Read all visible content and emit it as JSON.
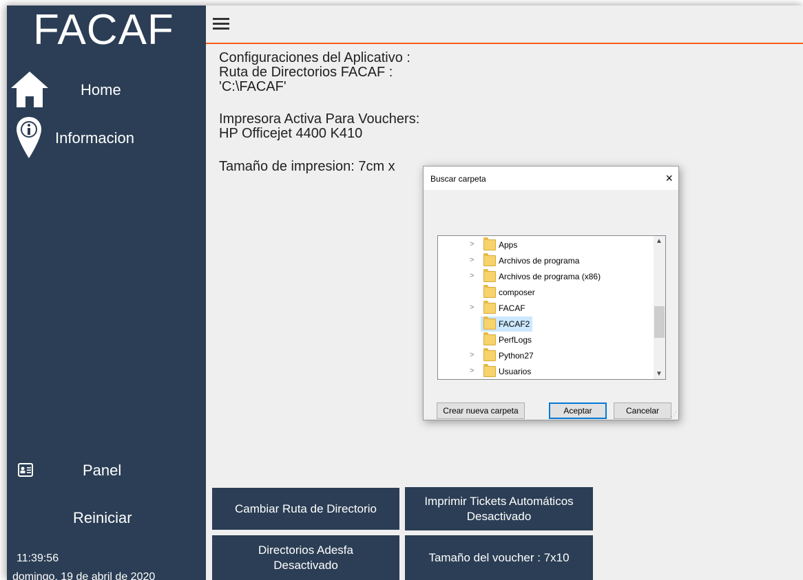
{
  "app": {
    "brand": "FACAF"
  },
  "sidebar": {
    "items": [
      {
        "label": "Home",
        "icon": "home-icon"
      },
      {
        "label": "Informacion",
        "icon": "info-pin-icon"
      },
      {
        "label": "Panel",
        "icon": "id-card-icon"
      },
      {
        "label": "Reiniciar"
      }
    ],
    "time": "11:39:56",
    "date": "domingo, 19 de abril de 2020"
  },
  "header": {
    "menu_icon": "hamburger-icon",
    "accent_color": "#ff5a14"
  },
  "main": {
    "lines": [
      "Configuraciones del Aplicativo :",
      "Ruta de Directorios FACAF :",
      "'C:\\FACAF'",
      "",
      "Impresora Activa Para Vouchers:",
      "HP Officejet 4400 K410",
      "",
      "Tamaño de impresion: 7cm x"
    ],
    "buttons": {
      "change_path": "Cambiar Ruta de Directorio",
      "print_tickets": "Imprimir Tickets Automáticos Desactivado",
      "adesfa_dirs": "Directorios Adesfa Desactivado",
      "voucher_size": "Tamaño del voucher : 7x10"
    }
  },
  "dialog": {
    "title": "Buscar carpeta",
    "close": "×",
    "folders": [
      {
        "name": "Apps",
        "expandable": true
      },
      {
        "name": "Archivos de programa",
        "expandable": true
      },
      {
        "name": "Archivos de programa (x86)",
        "expandable": true
      },
      {
        "name": "composer",
        "expandable": false
      },
      {
        "name": "FACAF",
        "expandable": true
      },
      {
        "name": "FACAF2",
        "expandable": false,
        "selected": true
      },
      {
        "name": "PerfLogs",
        "expandable": false
      },
      {
        "name": "Python27",
        "expandable": true
      },
      {
        "name": "Usuarios",
        "expandable": true
      }
    ],
    "buttons": {
      "new_folder": "Crear nueva carpeta",
      "accept": "Aceptar",
      "cancel": "Cancelar"
    }
  },
  "colors": {
    "sidebar": "#2b3e55",
    "button": "#2b3e55",
    "selection": "#cce8ff"
  }
}
